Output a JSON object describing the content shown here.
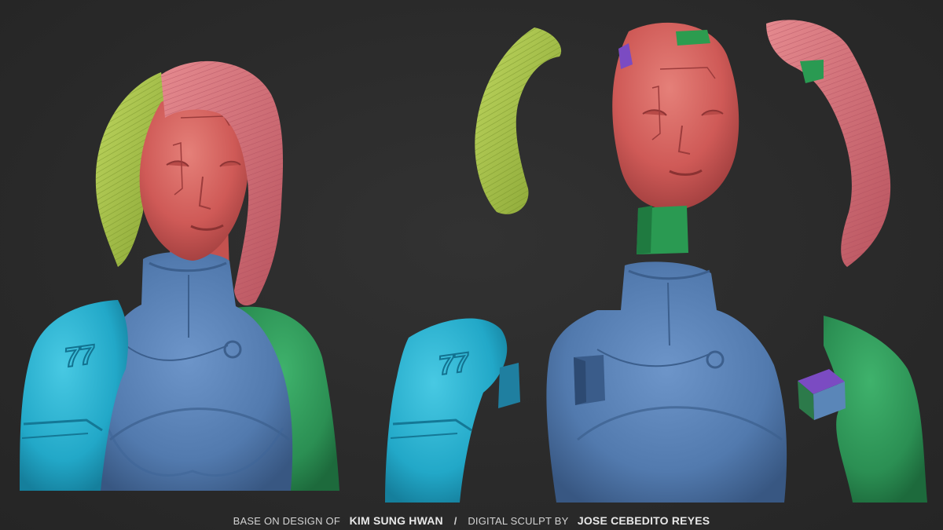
{
  "credit": {
    "prefix": "BASE ON DESIGN OF",
    "designer": "KIM SUNG HWAN",
    "separator": "/",
    "sculpt_prefix": "DIGITAL SCULPT BY",
    "sculptor": "JOSE CEBEDITO REYES"
  },
  "model": {
    "shoulder_number": "77",
    "colors": {
      "background": "#2b2b2b",
      "skin_red": "#d9625e",
      "hair_pink": "#d8727a",
      "hair_green": "#a6c24a",
      "suit_blue": "#5b83b8",
      "sleeve_cyan": "#2cb6d4",
      "sleeve_green": "#2f9a5a",
      "connector_purple": "#7b4bc2"
    }
  }
}
